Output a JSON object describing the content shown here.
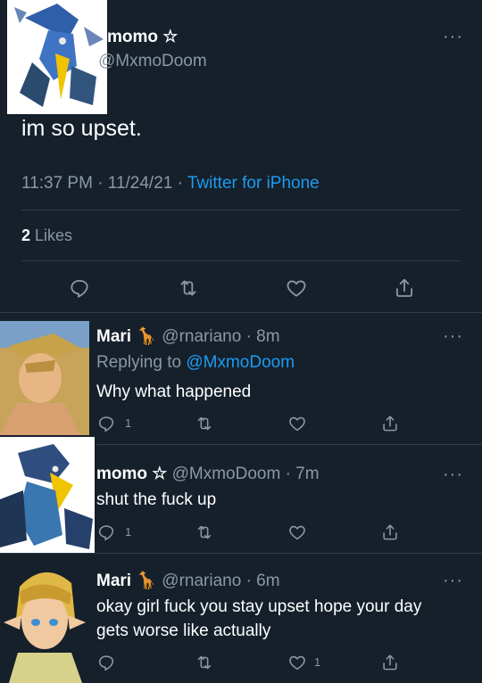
{
  "main_tweet": {
    "display_name": "momo ☆",
    "handle": "@MxmoDoom",
    "text": "im so upset.",
    "time": "11:37 PM · 11/24/21 · ",
    "source": "Twitter for iPhone",
    "likes_count": "2",
    "likes_label": "Likes"
  },
  "replies": [
    {
      "display_name": "Mari 🦒",
      "handle_time": "@rnariano · 8m",
      "replying_prefix": "Replying to ",
      "replying_to": "@MxmoDoom",
      "text": "Why what happened",
      "reply_count": "1",
      "retweet_count": "",
      "like_count": ""
    },
    {
      "display_name": "momo ☆",
      "handle_time": "@MxmoDoom · 7m",
      "text": "shut the fuck up",
      "reply_count": "1",
      "retweet_count": "",
      "like_count": ""
    },
    {
      "display_name": "Mari 🦒",
      "handle_time": "@rnariano · 6m",
      "text_line1": "okay girl fuck you stay upset hope your day",
      "text_line2": "gets worse like actually",
      "reply_count": "",
      "retweet_count": "",
      "like_count": "1"
    }
  ],
  "icons": {
    "reply": "reply-icon",
    "retweet": "retweet-icon",
    "like": "heart-icon",
    "share": "share-icon",
    "more": "more-icon"
  },
  "colors": {
    "background": "#15202b",
    "accent": "#1d9bf0",
    "muted": "#8b98a5",
    "divider": "#2f3b47"
  }
}
